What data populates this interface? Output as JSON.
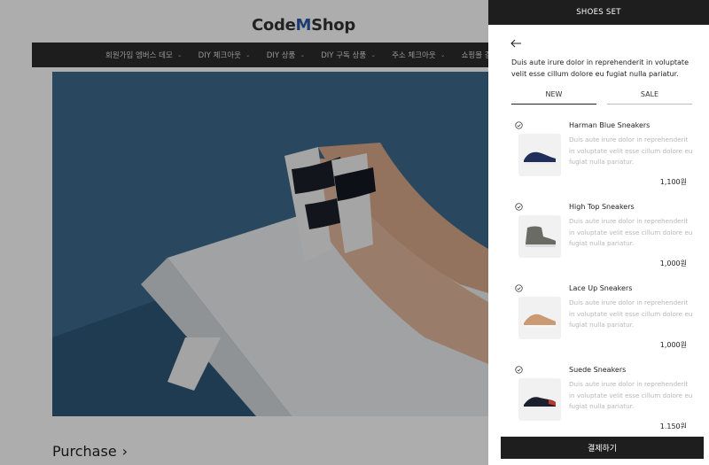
{
  "store": {
    "logo_prefix": "Code",
    "logo_m": "M",
    "logo_suffix": "Shop",
    "nav": [
      "회원가입 엠버스 데모",
      "DIY 체크아웃",
      "DIY 상품",
      "DIY 구독 상품",
      "주소 체크아웃",
      "쇼핑몰 결제 테스트"
    ],
    "purchase_label": "Purchase",
    "purchase_chevron": "›"
  },
  "panel": {
    "title": "SHOES SET",
    "description": "Duis aute irure dolor in reprehenderit in voluptate velit esse cillum dolore eu fugiat nulla pariatur.",
    "tabs": [
      {
        "label": "NEW",
        "active": true
      },
      {
        "label": "SALE",
        "active": false
      }
    ],
    "products": [
      {
        "name": "Harman Blue Sneakers",
        "description": "Duis aute irure dolor in reprehenderit in voluptate velit esse cillum dolore eu fugiat nulla pariatur.",
        "price": "1,100원",
        "color": "#1f2e5a"
      },
      {
        "name": "High Top Sneakers",
        "description": "Duis aute irure dolor in reprehenderit in voluptate velit esse cillum dolore eu fugiat nulla pariatur.",
        "price": "1,000원",
        "color": "#6b6b66"
      },
      {
        "name": "Lace Up Sneakers",
        "description": "Duis aute irure dolor in reprehenderit in voluptate velit esse cillum dolore eu fugiat nulla pariatur.",
        "price": "1,000원",
        "color": "#c99a74"
      },
      {
        "name": "Suede Sneakers",
        "description": "Duis aute irure dolor in reprehenderit in voluptate velit esse cillum dolore eu fugiat nulla pariatur.",
        "price": "1,150원",
        "color": "#1c1f2e"
      }
    ],
    "checkout_label": "결제하기"
  },
  "colors": {
    "accent": "#2a5aa8",
    "header_bg": "#1e1e1e",
    "hero_blue": "#3d6b8c"
  }
}
